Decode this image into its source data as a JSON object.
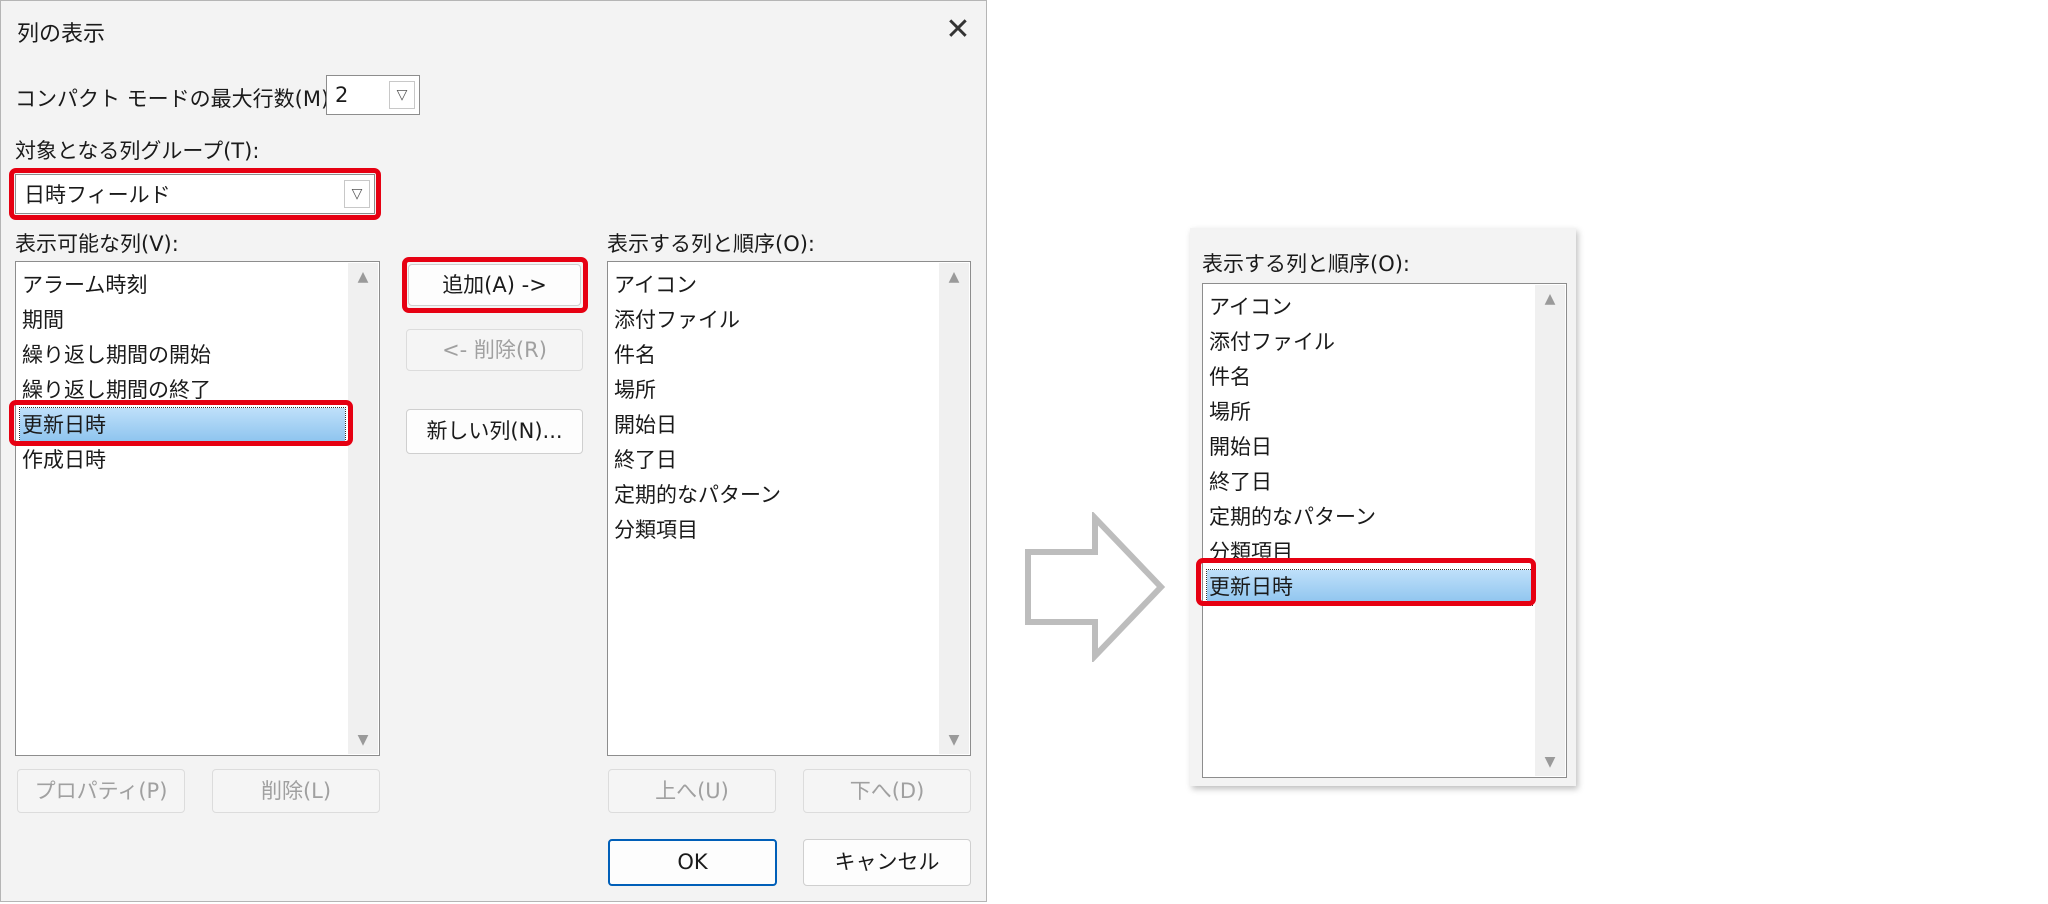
{
  "dialog": {
    "title": "列の表示",
    "close_icon": "✕",
    "compact_label": "コンパクト モードの最大行数(M):",
    "compact_value": "2",
    "group_label": "対象となる列グループ(T):",
    "group_value": "日時フィールド",
    "available_label": "表示可能な列(V):",
    "available_items": [
      "アラーム時刻",
      "期間",
      "繰り返し期間の開始",
      "繰り返し期間の終了",
      "更新日時",
      "作成日時"
    ],
    "available_selected": "更新日時",
    "shown_label": "表示する列と順序(O):",
    "shown_items": [
      "アイコン",
      "添付ファイル",
      "件名",
      "場所",
      "開始日",
      "終了日",
      "定期的なパターン",
      "分類項目"
    ],
    "buttons": {
      "add": "追加(A) ->",
      "remove": "<- 削除(R)",
      "new_column": "新しい列(N)...",
      "properties": "プロパティ(P)",
      "delete": "削除(L)",
      "up": "上へ(U)",
      "down": "下へ(D)",
      "ok": "OK",
      "cancel": "キャンセル"
    }
  },
  "result_panel": {
    "label": "表示する列と順序(O):",
    "items": [
      "アイコン",
      "添付ファイル",
      "件名",
      "場所",
      "開始日",
      "終了日",
      "定期的なパターン",
      "分類項目"
    ],
    "added_item": "更新日時"
  },
  "icons": {
    "arrow": "right-arrow-outline-icon",
    "chevron": "chevron-down-icon",
    "scroll_up": "▲",
    "scroll_down": "▼"
  },
  "colors": {
    "highlight_border": "#e60012",
    "selection": "#8cc3ee",
    "ok_border": "#005fb8"
  }
}
